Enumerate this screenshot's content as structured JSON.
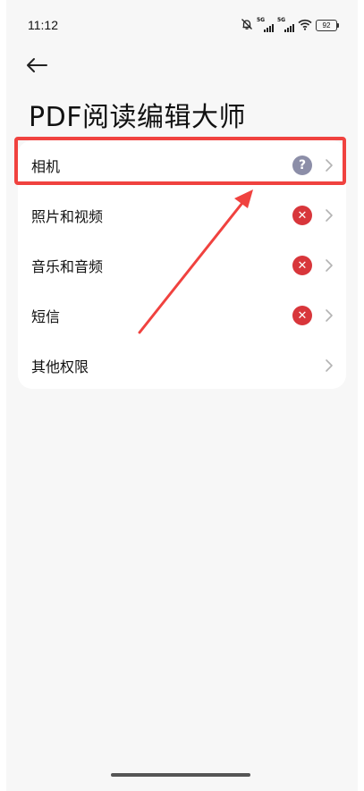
{
  "status_bar": {
    "time": "11:12",
    "signal_1_tag": "5G",
    "signal_2_tag": "5G",
    "battery": "92"
  },
  "title": "PDF阅读编辑大师",
  "permissions": [
    {
      "label": "相机",
      "status": "unknown",
      "status_symbol": "?",
      "status_color": "#8c8ea8"
    },
    {
      "label": "照片和视频",
      "status": "denied",
      "status_symbol": "✕",
      "status_color": "#d8363b"
    },
    {
      "label": "音乐和音频",
      "status": "denied",
      "status_symbol": "✕",
      "status_color": "#d8363b"
    },
    {
      "label": "短信",
      "status": "denied",
      "status_symbol": "✕",
      "status_color": "#d8363b"
    },
    {
      "label": "其他权限",
      "status": "none"
    }
  ],
  "icons": {
    "back": "arrow-left-icon",
    "mute": "bell-off-icon",
    "wifi": "wifi-icon",
    "chevron": "chevron-right-icon"
  },
  "annotation_color": "#f0423f"
}
